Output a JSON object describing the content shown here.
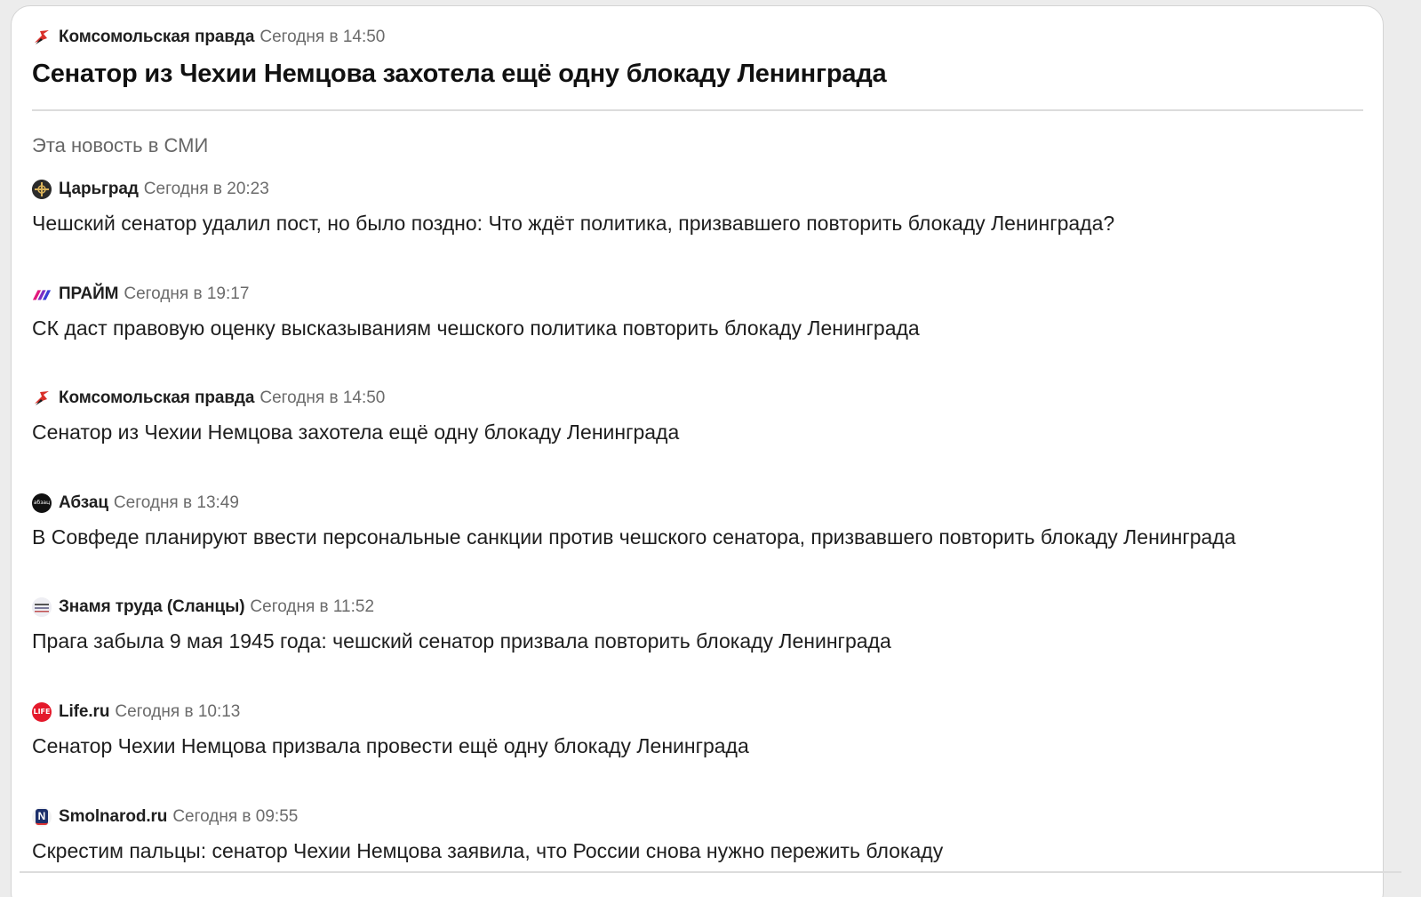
{
  "top": {
    "source": "Комсомольская правда",
    "time": "Сегодня в 14:50",
    "headline": "Сенатор из Чехии Немцова захотела ещё одну блокаду Ленинграда"
  },
  "section_title": "Эта новость в СМИ",
  "items": [
    {
      "source": "Царьград",
      "time": "Сегодня в 20:23",
      "title": "Чешский сенатор удалил пост, но было поздно: Что ждёт политика, призвавшего повторить блокаду Ленинграда?",
      "logo_icon": "tsargrad-logo-icon"
    },
    {
      "source": "ПРАЙМ",
      "time": "Сегодня в 19:17",
      "title": "СК даст правовую оценку высказываниям чешского политика повторить блокаду Ленинграда",
      "logo_icon": "prime-logo-icon"
    },
    {
      "source": "Комсомольская правда",
      "time": "Сегодня в 14:50",
      "title": "Сенатор из Чехии Немцова захотела ещё одну блокаду Ленинграда",
      "logo_icon": "kp-logo-icon"
    },
    {
      "source": "Абзац",
      "time": "Сегодня в 13:49",
      "title": "В Совфеде планируют ввести персональные санкции против чешского сенатора, призвавшего повторить блокаду Ленинграда",
      "logo_icon": "abzats-logo-icon",
      "logo_text": "абзац"
    },
    {
      "source": "Знамя труда (Сланцы)",
      "time": "Сегодня в 11:52",
      "title": "Прага забыла 9 мая 1945 года: чешский сенатор призвала повторить блокаду Ленинграда",
      "logo_icon": "znamya-truda-logo-icon"
    },
    {
      "source": "Life.ru",
      "time": "Сегодня в 10:13",
      "title": "Сенатор Чехии Немцова призвала провести ещё одну блокаду Ленинграда",
      "logo_icon": "life-logo-icon",
      "logo_text": "LIFE"
    },
    {
      "source": "Smolnarod.ru",
      "time": "Сегодня в 09:55",
      "title": "Скрестим пальцы: сенатор Чехии Немцова заявила, что России снова нужно пережить блокаду",
      "logo_icon": "smolnarod-logo-icon",
      "logo_text": "N"
    }
  ],
  "colors": {
    "card_bg": "#ffffff",
    "page_bg": "#ececec",
    "time": "#6b6b6b",
    "section": "#666666",
    "life_red": "#e4192b",
    "kp_red": "#d9302a"
  }
}
